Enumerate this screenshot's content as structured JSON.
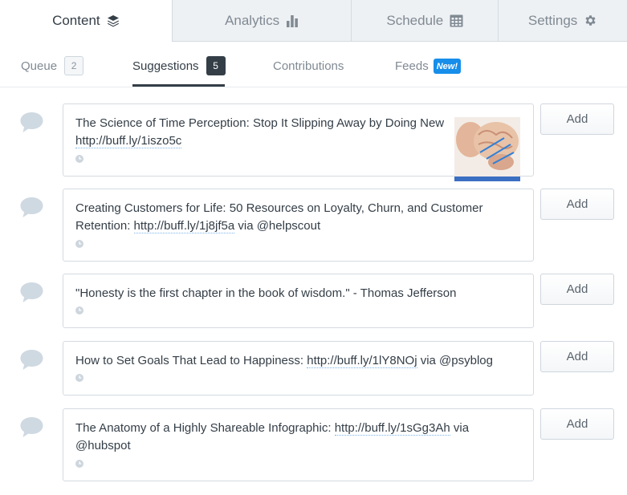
{
  "top_tabs": [
    {
      "label": "Content",
      "icon": "layers-icon",
      "active": true
    },
    {
      "label": "Analytics",
      "icon": "bar-chart-icon",
      "active": false
    },
    {
      "label": "Schedule",
      "icon": "calendar-icon",
      "active": false
    },
    {
      "label": "Settings",
      "icon": "gear-icon",
      "active": false
    }
  ],
  "sub_tabs": {
    "queue": {
      "label": "Queue",
      "count": "2"
    },
    "suggestions": {
      "label": "Suggestions",
      "count": "5"
    },
    "contributions": {
      "label": "Contributions"
    },
    "feeds": {
      "label": "Feeds",
      "badge": "New!"
    }
  },
  "suggestions": [
    {
      "pre": "The Science of Time Perception: Stop It Slipping Away by Doing New T",
      "link": "http://buff.ly/1iszo5c",
      "post": "",
      "has_thumbnail": true,
      "add_label": "Add"
    },
    {
      "pre": "Creating Customers for Life: 50 Resources on Loyalty, Churn, and Customer Retention: ",
      "link": "http://buff.ly/1j8jf5a",
      "post": " via @helpscout",
      "has_thumbnail": false,
      "add_label": "Add"
    },
    {
      "pre": "\"Honesty is the first chapter in the book of wisdom.\" - Thomas Jefferson",
      "link": "",
      "post": "",
      "has_thumbnail": false,
      "add_label": "Add"
    },
    {
      "pre": "How to Set Goals That Lead to Happiness: ",
      "link": "http://buff.ly/1lY8NOj",
      "post": " via @psyblog",
      "has_thumbnail": false,
      "add_label": "Add"
    },
    {
      "pre": "The Anatomy of a Highly Shareable Infographic: ",
      "link": "http://buff.ly/1sGg3Ah",
      "post": " via @hubspot",
      "has_thumbnail": false,
      "add_label": "Add"
    }
  ],
  "colors": {
    "accent": "#168eea",
    "dark": "#343e47",
    "muted": "#808a93"
  }
}
